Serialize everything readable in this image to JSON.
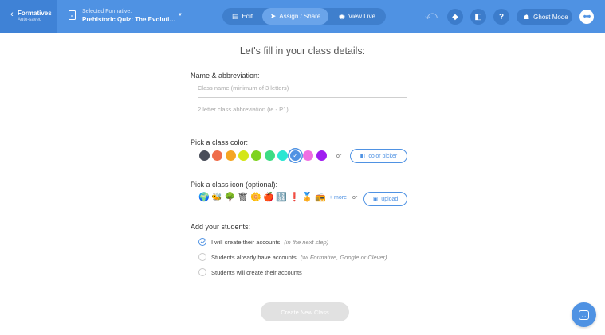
{
  "header": {
    "back_title": "Formatives",
    "back_sub": "Auto-saved",
    "selected_label": "Selected Formative:",
    "selected_title": "Prehistoric Quiz: The Evolution...",
    "tabs": [
      {
        "label": "Edit",
        "icon": "edit-icon"
      },
      {
        "label": "Assign / Share",
        "icon": "paper-plane-icon",
        "active": true
      },
      {
        "label": "View Live",
        "icon": "eye-chat-icon"
      }
    ],
    "ghost_label": "Ghost Mode",
    "colors": {
      "bar": "#4f92e3",
      "dark": "#3c7ccb",
      "active_tab": "#6aa4ea"
    }
  },
  "form": {
    "heading": "Let's fill in your class details:",
    "name_section": "Name & abbreviation:",
    "class_name_placeholder": "Class name (minimum of 3 letters)",
    "abbrev_placeholder": "2 letter class abbreviation (ie - P1)",
    "color_section": "Pick a class color:",
    "colors": [
      "#4a4e5a",
      "#ef6d4b",
      "#f5a623",
      "#d4e617",
      "#7ed321",
      "#3ddc84",
      "#2ae6d2",
      "#4f92e3",
      "#f06ee2",
      "#a01df0"
    ],
    "selected_color_index": 7,
    "or_text": "or",
    "color_picker_label": "color picker",
    "icon_section": "Pick a class icon (optional):",
    "icons": [
      "🌍",
      "🐝",
      "🌳",
      "🗑",
      "🌼",
      "🍎",
      "🔢",
      "❗",
      "🏅",
      "📻"
    ],
    "more_label": "+ more",
    "upload_label": "upload",
    "students_section": "Add your students:",
    "options": [
      {
        "label": "I will create their accounts",
        "hint": "(in the next step)",
        "checked": true
      },
      {
        "label": "Students already have accounts",
        "hint": "(w/ Formative, Google or Clever)",
        "checked": false
      },
      {
        "label": "Students will create their accounts",
        "hint": "",
        "checked": false
      }
    ],
    "create_button": "Create New Class"
  }
}
